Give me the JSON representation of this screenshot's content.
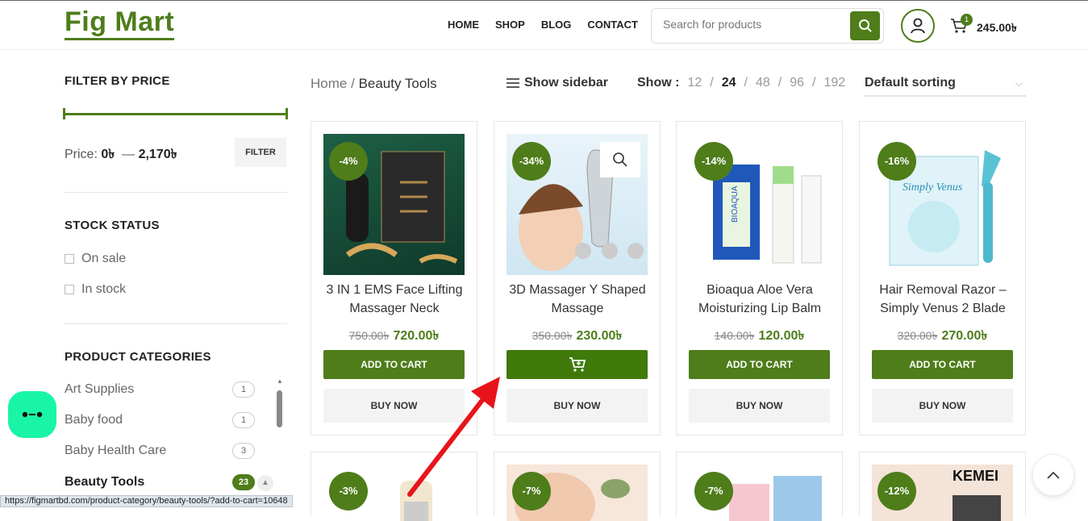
{
  "header": {
    "logo": "Fig Mart",
    "nav": [
      "HOME",
      "SHOP",
      "BLOG",
      "CONTACT"
    ],
    "search_placeholder": "Search for products",
    "cart_count": "1",
    "cart_total": "245.00৳"
  },
  "sidebar": {
    "filter_title": "FILTER BY PRICE",
    "price_label": "Price:",
    "price_min": "0৳",
    "price_sep": "—",
    "price_max": "2,170৳",
    "filter_button": "FILTER",
    "stock_title": "STOCK STATUS",
    "stock_options": [
      "On sale",
      "In stock"
    ],
    "categories_title": "PRODUCT CATEGORIES",
    "categories": [
      {
        "name": "Art Supplies",
        "count": "1"
      },
      {
        "name": "Baby food",
        "count": "1"
      },
      {
        "name": "Baby Health Care",
        "count": "3"
      },
      {
        "name": "Beauty Tools",
        "count": "23"
      }
    ]
  },
  "toolbar": {
    "breadcrumb_home": "Home",
    "breadcrumb_sep": "/",
    "breadcrumb_current": "Beauty Tools",
    "show_sidebar": "Show sidebar",
    "show_label": "Show :",
    "per_page": [
      "12",
      "24",
      "48",
      "96",
      "192"
    ],
    "per_page_active": "24",
    "sorting": "Default sorting"
  },
  "products": [
    {
      "badge": "-4%",
      "title": "3 IN 1 EMS Face Lifting Massager Neck",
      "old_price": "750.00৳",
      "new_price": "720.00৳",
      "add_label": "ADD TO CART",
      "buy_label": "BUY NOW"
    },
    {
      "badge": "-34%",
      "title": "3D Massager Y Shaped Massage",
      "old_price": "350.00৳",
      "new_price": "230.00৳",
      "add_label": "",
      "buy_label": "BUY NOW"
    },
    {
      "badge": "-14%",
      "title": "Bioaqua Aloe Vera Moisturizing Lip Balm",
      "old_price": "140.00৳",
      "new_price": "120.00৳",
      "add_label": "ADD TO CART",
      "buy_label": "BUY NOW"
    },
    {
      "badge": "-16%",
      "title": "Hair Removal Razor – Simply Venus 2 Blade",
      "old_price": "320.00৳",
      "new_price": "270.00৳",
      "add_label": "ADD TO CART",
      "buy_label": "BUY NOW"
    }
  ],
  "products_row2": [
    {
      "badge": "-3%"
    },
    {
      "badge": "-7%"
    },
    {
      "badge": "-7%"
    },
    {
      "badge": "-12%",
      "brand_text": "KEMEI"
    }
  ],
  "image_text": {
    "bioaqua": "BIOAQUA",
    "venus": "Simply Venus"
  },
  "status_url": "https://figmartbd.com/product-category/beauty-tools/?add-to-cart=10648",
  "colors": {
    "brand": "#4e7d1a",
    "chat": "#19f5a6",
    "arrow": "#e8141b"
  }
}
